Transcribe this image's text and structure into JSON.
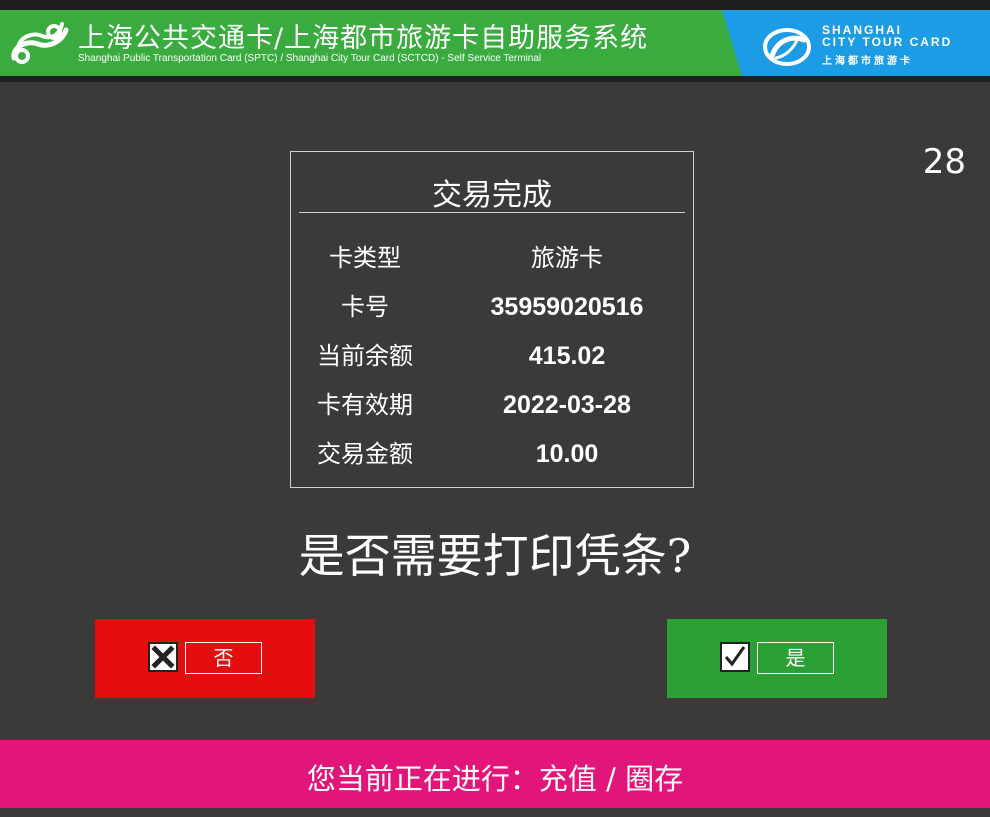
{
  "header": {
    "title": "上海公共交通卡/上海都市旅游卡自助服务系统",
    "subtitle": "Shanghai Public Transportation Card (SPTC) / Shanghai City Tour Card (SCTCD) - Self Service Terminal",
    "tour_card_en": "SHANGHAI\nCITY TOUR CARD",
    "tour_card_cn": "上海都市旅游卡",
    "logo_icon": "sptc-logo-icon",
    "tour_logo_icon": "city-tour-card-logo-icon"
  },
  "countdown": "28",
  "receipt": {
    "title": "交易完成",
    "rows": [
      {
        "label": "卡类型",
        "value": "旅游卡"
      },
      {
        "label": "卡号",
        "value": "35959020516"
      },
      {
        "label": "当前余额",
        "value": "415.02"
      },
      {
        "label": "卡有效期",
        "value": "2022-03-28"
      },
      {
        "label": "交易金额",
        "value": "10.00"
      }
    ]
  },
  "question": "是否需要打印凭条?",
  "buttons": {
    "no_label": "否",
    "yes_label": "是"
  },
  "footer": {
    "text": "您当前正在进行：充值 / 圈存"
  },
  "colors": {
    "background": "#3c3a39",
    "header_green": "#3aab3f",
    "header_blue": "#1c9ce4",
    "no_button": "#e40e11",
    "yes_button": "#2ba035",
    "footer": "#e2157a"
  }
}
